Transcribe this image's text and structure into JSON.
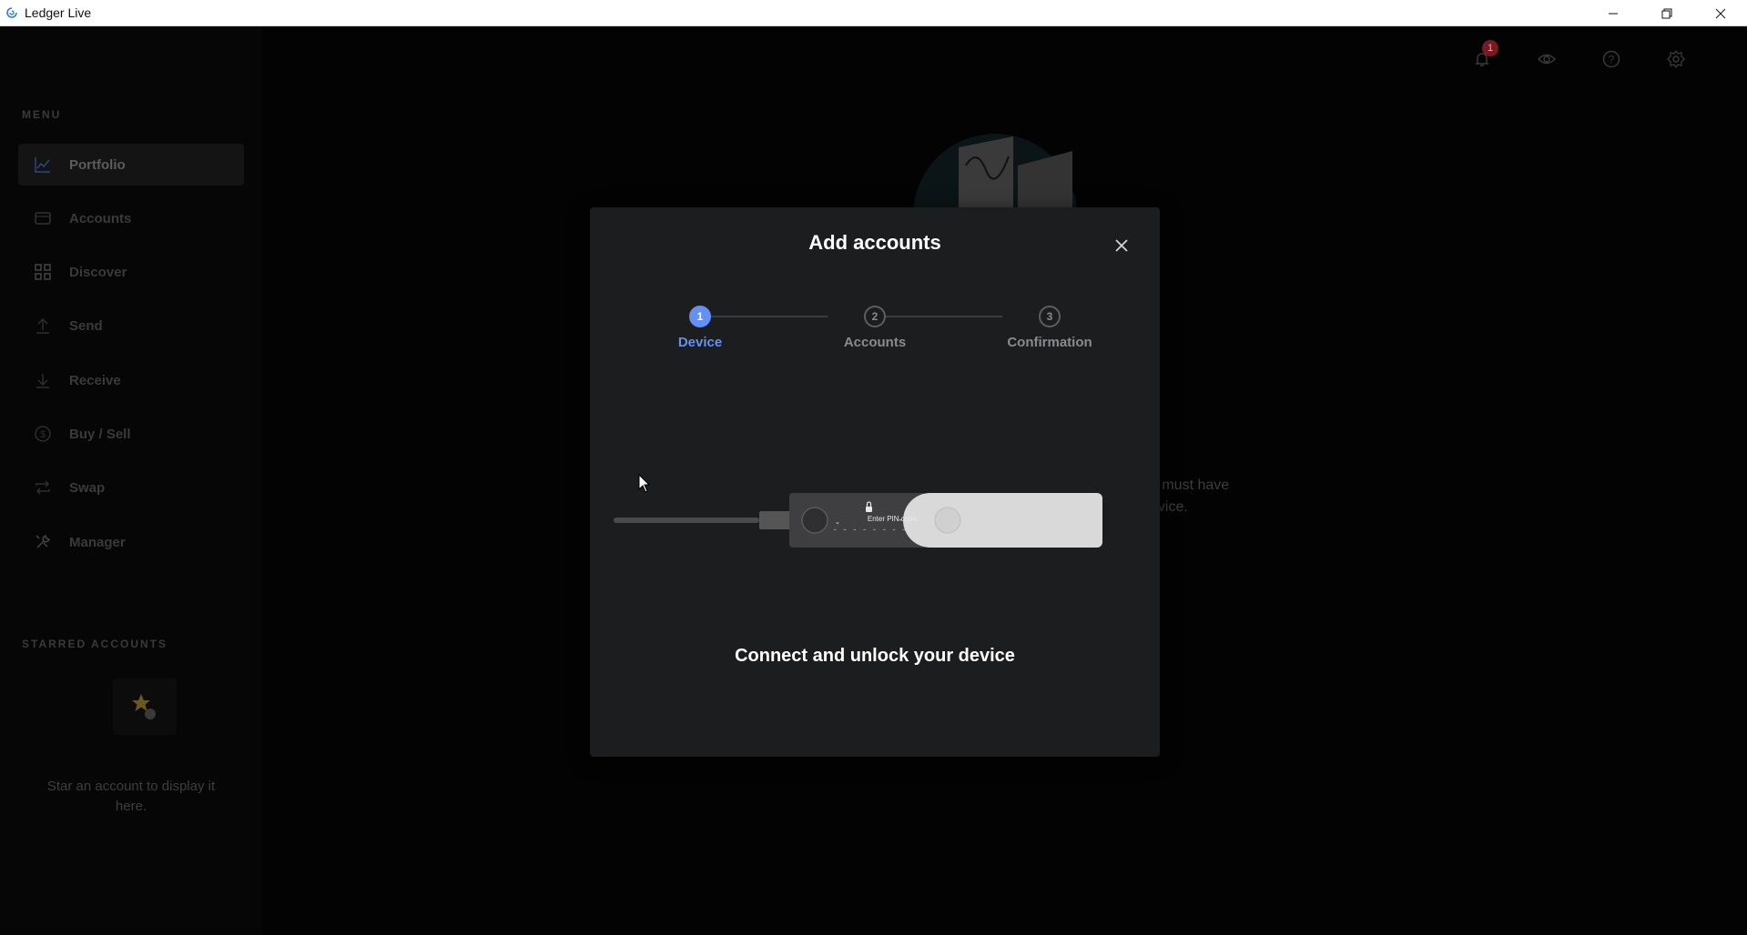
{
  "window": {
    "title": "Ledger Live",
    "controls": [
      "minimize-icon",
      "restore-icon",
      "close-icon"
    ]
  },
  "sidebar": {
    "menu_title": "MENU",
    "items": [
      {
        "label": "Portfolio",
        "icon": "chart-line-icon",
        "active": true
      },
      {
        "label": "Accounts",
        "icon": "wallet-icon",
        "active": false
      },
      {
        "label": "Discover",
        "icon": "grid-icon",
        "active": false
      },
      {
        "label": "Send",
        "icon": "upload-arrow-icon",
        "active": false
      },
      {
        "label": "Receive",
        "icon": "download-arrow-icon",
        "active": false
      },
      {
        "label": "Buy / Sell",
        "icon": "dollar-circle-icon",
        "active": false
      },
      {
        "label": "Swap",
        "icon": "swap-arrows-icon",
        "active": false
      },
      {
        "label": "Manager",
        "icon": "tools-icon",
        "active": false
      }
    ],
    "starred_title": "STARRED ACCOUNTS",
    "starred_hint": "Star an account to display it here."
  },
  "topbar": {
    "notification_count": "1",
    "icons": [
      "bell-icon",
      "eye-icon",
      "help-circle-icon",
      "settings-gear-icon"
    ]
  },
  "background_text": {
    "line1": "u must have",
    "line2": "evice."
  },
  "modal": {
    "title": "Add accounts",
    "steps": [
      {
        "number": "1",
        "label": "Device",
        "active": true
      },
      {
        "number": "2",
        "label": "Accounts",
        "active": false
      },
      {
        "number": "3",
        "label": "Confirmation",
        "active": false
      }
    ],
    "device_screen_text": "Enter PIN code",
    "instruction": "Connect and unlock your device"
  },
  "colors": {
    "accent": "#6490f1",
    "modal_bg": "#1c1d1f",
    "badge": "#7a1a1e"
  }
}
